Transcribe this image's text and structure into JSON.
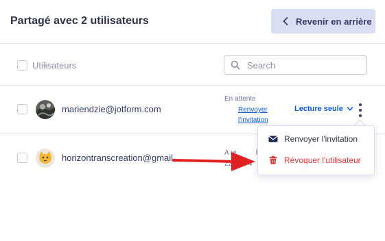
{
  "header": {
    "title": "Partagé avec 2 utilisateurs",
    "back_label": "Revenir en arrière"
  },
  "list_header": {
    "column_label": "Utilisateurs",
    "search_placeholder": "Search"
  },
  "users": [
    {
      "email": "mariendzie@jotform.com",
      "status": "En attente",
      "resend_line1": "Renvoyer",
      "resend_line2": "l'invitation",
      "permission": "Lecture seule"
    },
    {
      "email": "horizontranscreation@gmail.",
      "status_line1": "A re",
      "status_line1_tail": "l",
      "status_line2": "22,",
      "status_line2_tail": "4"
    }
  ],
  "menu": {
    "items": [
      {
        "label": "Renvoyer l'invitation",
        "icon": "envelope-icon"
      },
      {
        "label": "Révoquer l'utilisateur",
        "icon": "trash-icon"
      }
    ]
  },
  "colors": {
    "accent_blue": "#0a5ad4",
    "danger_red": "#e3343a",
    "back_button_bg": "#dadef3",
    "arrow_red": "#e0211f"
  }
}
